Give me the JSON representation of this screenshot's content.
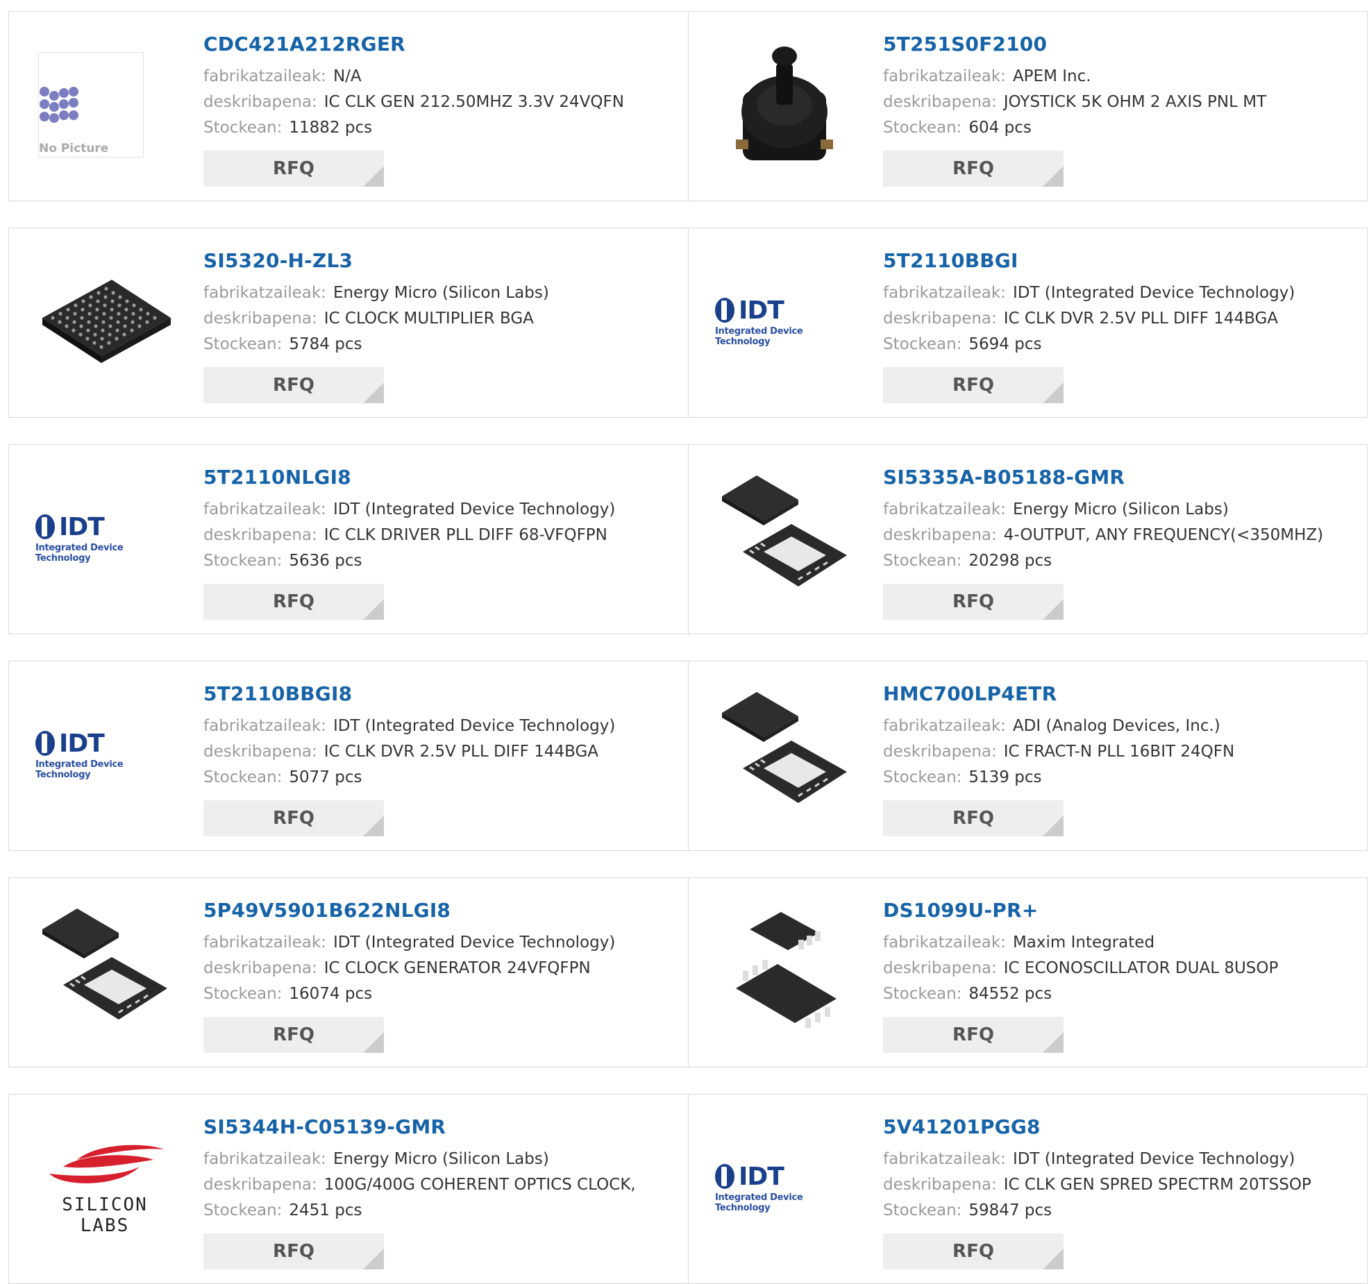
{
  "labels": {
    "manufacturer": "fabrikatzaileak:",
    "description": "deskribapena:",
    "stock": "Stockean:",
    "rfq": "RFQ"
  },
  "no_picture": "No Picture",
  "idt_logo": {
    "word": "IDT",
    "sub": "Integrated Device Technology"
  },
  "silicon_labs_logo": {
    "word": "SILICON LABS"
  },
  "products": [
    {
      "pn": "CDC421A212RGER",
      "mfr": "N/A",
      "desc": "IC CLK GEN 212.50MHZ 3.3V 24VQFN",
      "stock": "11882 pcs",
      "image": "no-picture-icon"
    },
    {
      "pn": "5T251S0F2100",
      "mfr": "APEM Inc.",
      "desc": "JOYSTICK 5K OHM 2 AXIS PNL MT",
      "stock": "604 pcs",
      "image": "joystick-image"
    },
    {
      "pn": "SI5320-H-ZL3",
      "mfr": "Energy Micro (Silicon Labs)",
      "desc": "IC CLOCK MULTIPLIER BGA",
      "stock": "5784 pcs",
      "image": "bga-chip-image"
    },
    {
      "pn": "5T2110BBGI",
      "mfr": "IDT (Integrated Device Technology)",
      "desc": "IC CLK DVR 2.5V PLL DIFF 144BGA",
      "stock": "5694 pcs",
      "image": "idt-logo"
    },
    {
      "pn": "5T2110NLGI8",
      "mfr": "IDT (Integrated Device Technology)",
      "desc": "IC CLK DRIVER PLL DIFF 68-VFQFPN",
      "stock": "5636 pcs",
      "image": "idt-logo"
    },
    {
      "pn": "SI5335A-B05188-GMR",
      "mfr": "Energy Micro (Silicon Labs)",
      "desc": "4-OUTPUT, ANY FREQUENCY(<350MHZ)",
      "stock": "20298 pcs",
      "image": "qfn-chip-image"
    },
    {
      "pn": "5T2110BBGI8",
      "mfr": "IDT (Integrated Device Technology)",
      "desc": "IC CLK DVR 2.5V PLL DIFF 144BGA",
      "stock": "5077 pcs",
      "image": "idt-logo"
    },
    {
      "pn": "HMC700LP4ETR",
      "mfr": "ADI (Analog Devices, Inc.)",
      "desc": "IC FRACT-N PLL 16BIT 24QFN",
      "stock": "5139 pcs",
      "image": "qfn-chip-image"
    },
    {
      "pn": "5P49V5901B622NLGI8",
      "mfr": "IDT (Integrated Device Technology)",
      "desc": "IC CLOCK GENERATOR 24VFQFPN",
      "stock": "16074 pcs",
      "image": "qfn-chip-image"
    },
    {
      "pn": "DS1099U-PR+",
      "mfr": "Maxim Integrated",
      "desc": "IC ECONOSCILLATOR DUAL 8USOP",
      "stock": "84552 pcs",
      "image": "usop-chip-image"
    },
    {
      "pn": "SI5344H-C05139-GMR",
      "mfr": "Energy Micro (Silicon Labs)",
      "desc": "100G/400G COHERENT OPTICS CLOCK,",
      "stock": "2451 pcs",
      "image": "silicon-labs-logo"
    },
    {
      "pn": "5V41201PGG8",
      "mfr": "IDT (Integrated Device Technology)",
      "desc": "IC CLK GEN SPRED SPECTRM 20TSSOP",
      "stock": "59847 pcs",
      "image": "idt-logo"
    }
  ]
}
